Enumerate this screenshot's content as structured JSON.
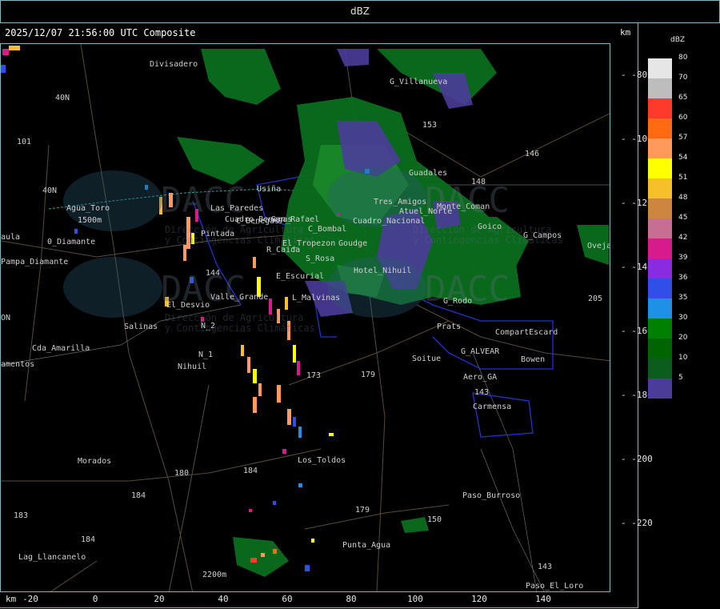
{
  "title": "dBZ",
  "header": "2025/12/07 21:56:00 UTC Composite",
  "km_label_top": "km",
  "km_label_bottom": "km",
  "y_ticks": [
    "-80",
    "-100",
    "-120",
    "-140",
    "-160",
    "-180",
    "-200",
    "-220"
  ],
  "x_ticks": [
    "-20",
    "0",
    "20",
    "40",
    "60",
    "80",
    "100",
    "120",
    "140"
  ],
  "legend": {
    "title": "dBZ",
    "items": [
      {
        "label": "80",
        "color": "#e6e6e6"
      },
      {
        "label": "70",
        "color": "#bdbdbd"
      },
      {
        "label": "65",
        "color": "#ff3a2a"
      },
      {
        "label": "60",
        "color": "#ff6a12"
      },
      {
        "label": "57",
        "color": "#ff9a5c"
      },
      {
        "label": "54",
        "color": "#ffff00"
      },
      {
        "label": "51",
        "color": "#f7c02a"
      },
      {
        "label": "48",
        "color": "#cd853f"
      },
      {
        "label": "45",
        "color": "#c86e92"
      },
      {
        "label": "42",
        "color": "#d81b8c"
      },
      {
        "label": "39",
        "color": "#8a2be2"
      },
      {
        "label": "36",
        "color": "#2f4fe8"
      },
      {
        "label": "35",
        "color": "#1e90e6"
      },
      {
        "label": "30",
        "color": "#008000"
      },
      {
        "label": "20",
        "color": "#006400"
      },
      {
        "label": "10",
        "color": "#0b5d1e"
      },
      {
        "label": "5",
        "color": "#4b3c9a"
      }
    ]
  },
  "places": [
    "Divisadero",
    "G_Villanueva",
    "153",
    "146",
    "Guadales",
    "148",
    "Usiña",
    "Agua_Toro",
    "1500m",
    "San_Rafael",
    "C_Benegas",
    "Las_Paredes",
    "C_Bombal",
    "El_Tropezon",
    "Goudge",
    "Cuadro_Nacional",
    "Pintada",
    "R_Caida",
    "S_Rosa",
    "Hotel_Nihuil",
    "Atuel_Norte",
    "Monte_Coman",
    "Goico",
    "G_Campos",
    "Ovejas",
    "E_Escurial",
    "L_Malvinas",
    "Valle_Grande",
    "El_Desvio",
    "Salinas",
    "N_2",
    "N_1",
    "Nihuil",
    "Cda_Amarilla",
    "Pampa_Diamante",
    "Soitue",
    "G_ALVEAR",
    "Prats",
    "CompartEscard",
    "Bowen",
    "Aero_GA",
    "Carmensa",
    "Los_Toldos",
    "Morados",
    "Paso_Burroso",
    "Punta_Agua",
    "Lag_Llancanelo",
    "Paso_El_Loro",
    "2200m",
    "101",
    "40N",
    "40N",
    "144",
    "180",
    "184",
    "179",
    "184",
    "183",
    "184",
    "179",
    "150",
    "173",
    "143",
    "143",
    "205",
    "Tres_Amigos",
    "G_Rodo",
    "aula",
    "amentos",
    "0_Diamante",
    "ON",
    "Cuadro_Benegas"
  ],
  "watermark": {
    "brand": "DACC",
    "line1": "Dirección de Agricultura",
    "line2": "y Contingencias Climáticas"
  }
}
